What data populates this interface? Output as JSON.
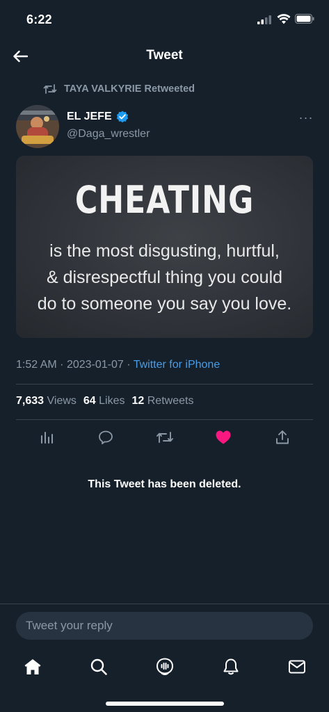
{
  "status_bar": {
    "time": "6:22"
  },
  "header": {
    "title": "Tweet"
  },
  "retweet_context": {
    "text": "TAYA VALKYRIE Retweeted"
  },
  "author": {
    "name": "EL JEFE",
    "handle": "@Daga_wrestler"
  },
  "tweet_image": {
    "heading": "CHEATING",
    "lines": [
      "is the most disgusting, hurtful,",
      "& disrespectful thing you could",
      "do to someone you say you love."
    ]
  },
  "meta": {
    "time": "1:52 AM",
    "date": "2023-01-07",
    "separator": "·",
    "source": "Twitter for iPhone"
  },
  "stats": {
    "views_count": "7,633",
    "views_label": "Views",
    "likes_count": "64",
    "likes_label": "Likes",
    "retweets_count": "12",
    "retweets_label": "Retweets"
  },
  "actions": [
    "analytics-icon",
    "reply-icon",
    "retweet-icon",
    "like-icon",
    "share-icon"
  ],
  "deleted_note": "This Tweet has been deleted.",
  "reply": {
    "placeholder": "Tweet your reply"
  },
  "tab_bar": [
    "home-icon",
    "search-icon",
    "spaces-icon",
    "notifications-icon",
    "messages-icon"
  ],
  "colors": {
    "background": "#15202b",
    "accent": "#1d9bf0",
    "link": "#4a9de6",
    "like": "#f91880",
    "muted": "#8b98a5"
  }
}
